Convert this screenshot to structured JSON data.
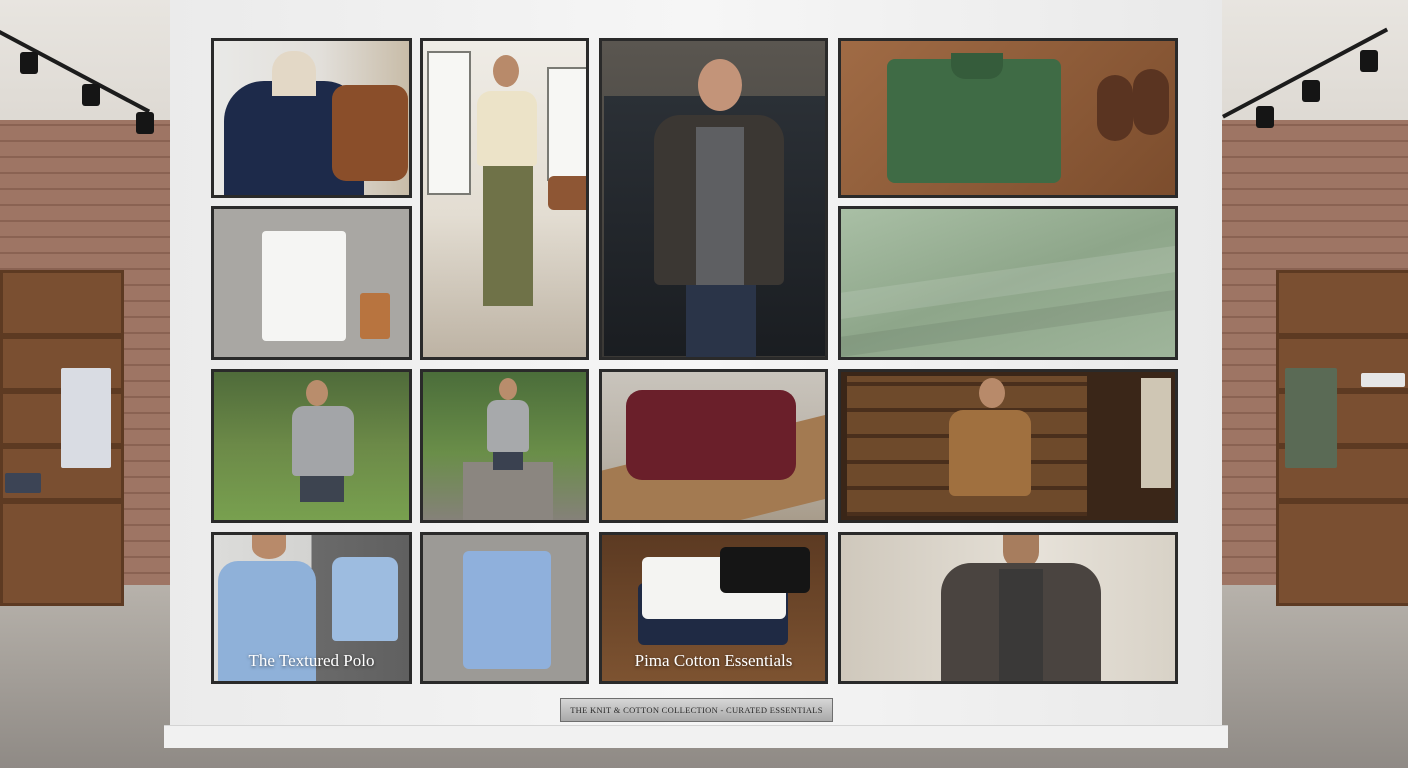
{
  "gallery": {
    "tiles": [
      {
        "subject": "navy knit polo on mannequin"
      },
      {
        "subject": "man in cream polo and olive trousers"
      },
      {
        "subject": "man in leather jacket by classic car"
      },
      {
        "subject": "folded green polo with loafers"
      },
      {
        "subject": "white tee with leather wallet"
      },
      {
        "subject": "sage green fabric close-up"
      },
      {
        "subject": "man in grey sweater in park"
      },
      {
        "subject": "man in grey sweater on path"
      },
      {
        "subject": "folded burgundy sweatshirt on bench"
      },
      {
        "subject": "man in tan sweater in library"
      },
      {
        "subject": "man in light blue polo",
        "caption": "The Textured Polo"
      },
      {
        "subject": "folded light blue polo"
      },
      {
        "subject": "stack of folded tees",
        "caption": "Pima Cotton Essentials"
      },
      {
        "subject": "man in leather jacket by window"
      }
    ]
  },
  "plaque": {
    "text": "THE KNIT & COTTON COLLECTION - CURATED ESSENTIALS"
  },
  "colors": {
    "frame": "#2a2a2a",
    "display_wall": "#f2f2f2",
    "brick": "#9a7060",
    "wood": "#7a4f31"
  }
}
